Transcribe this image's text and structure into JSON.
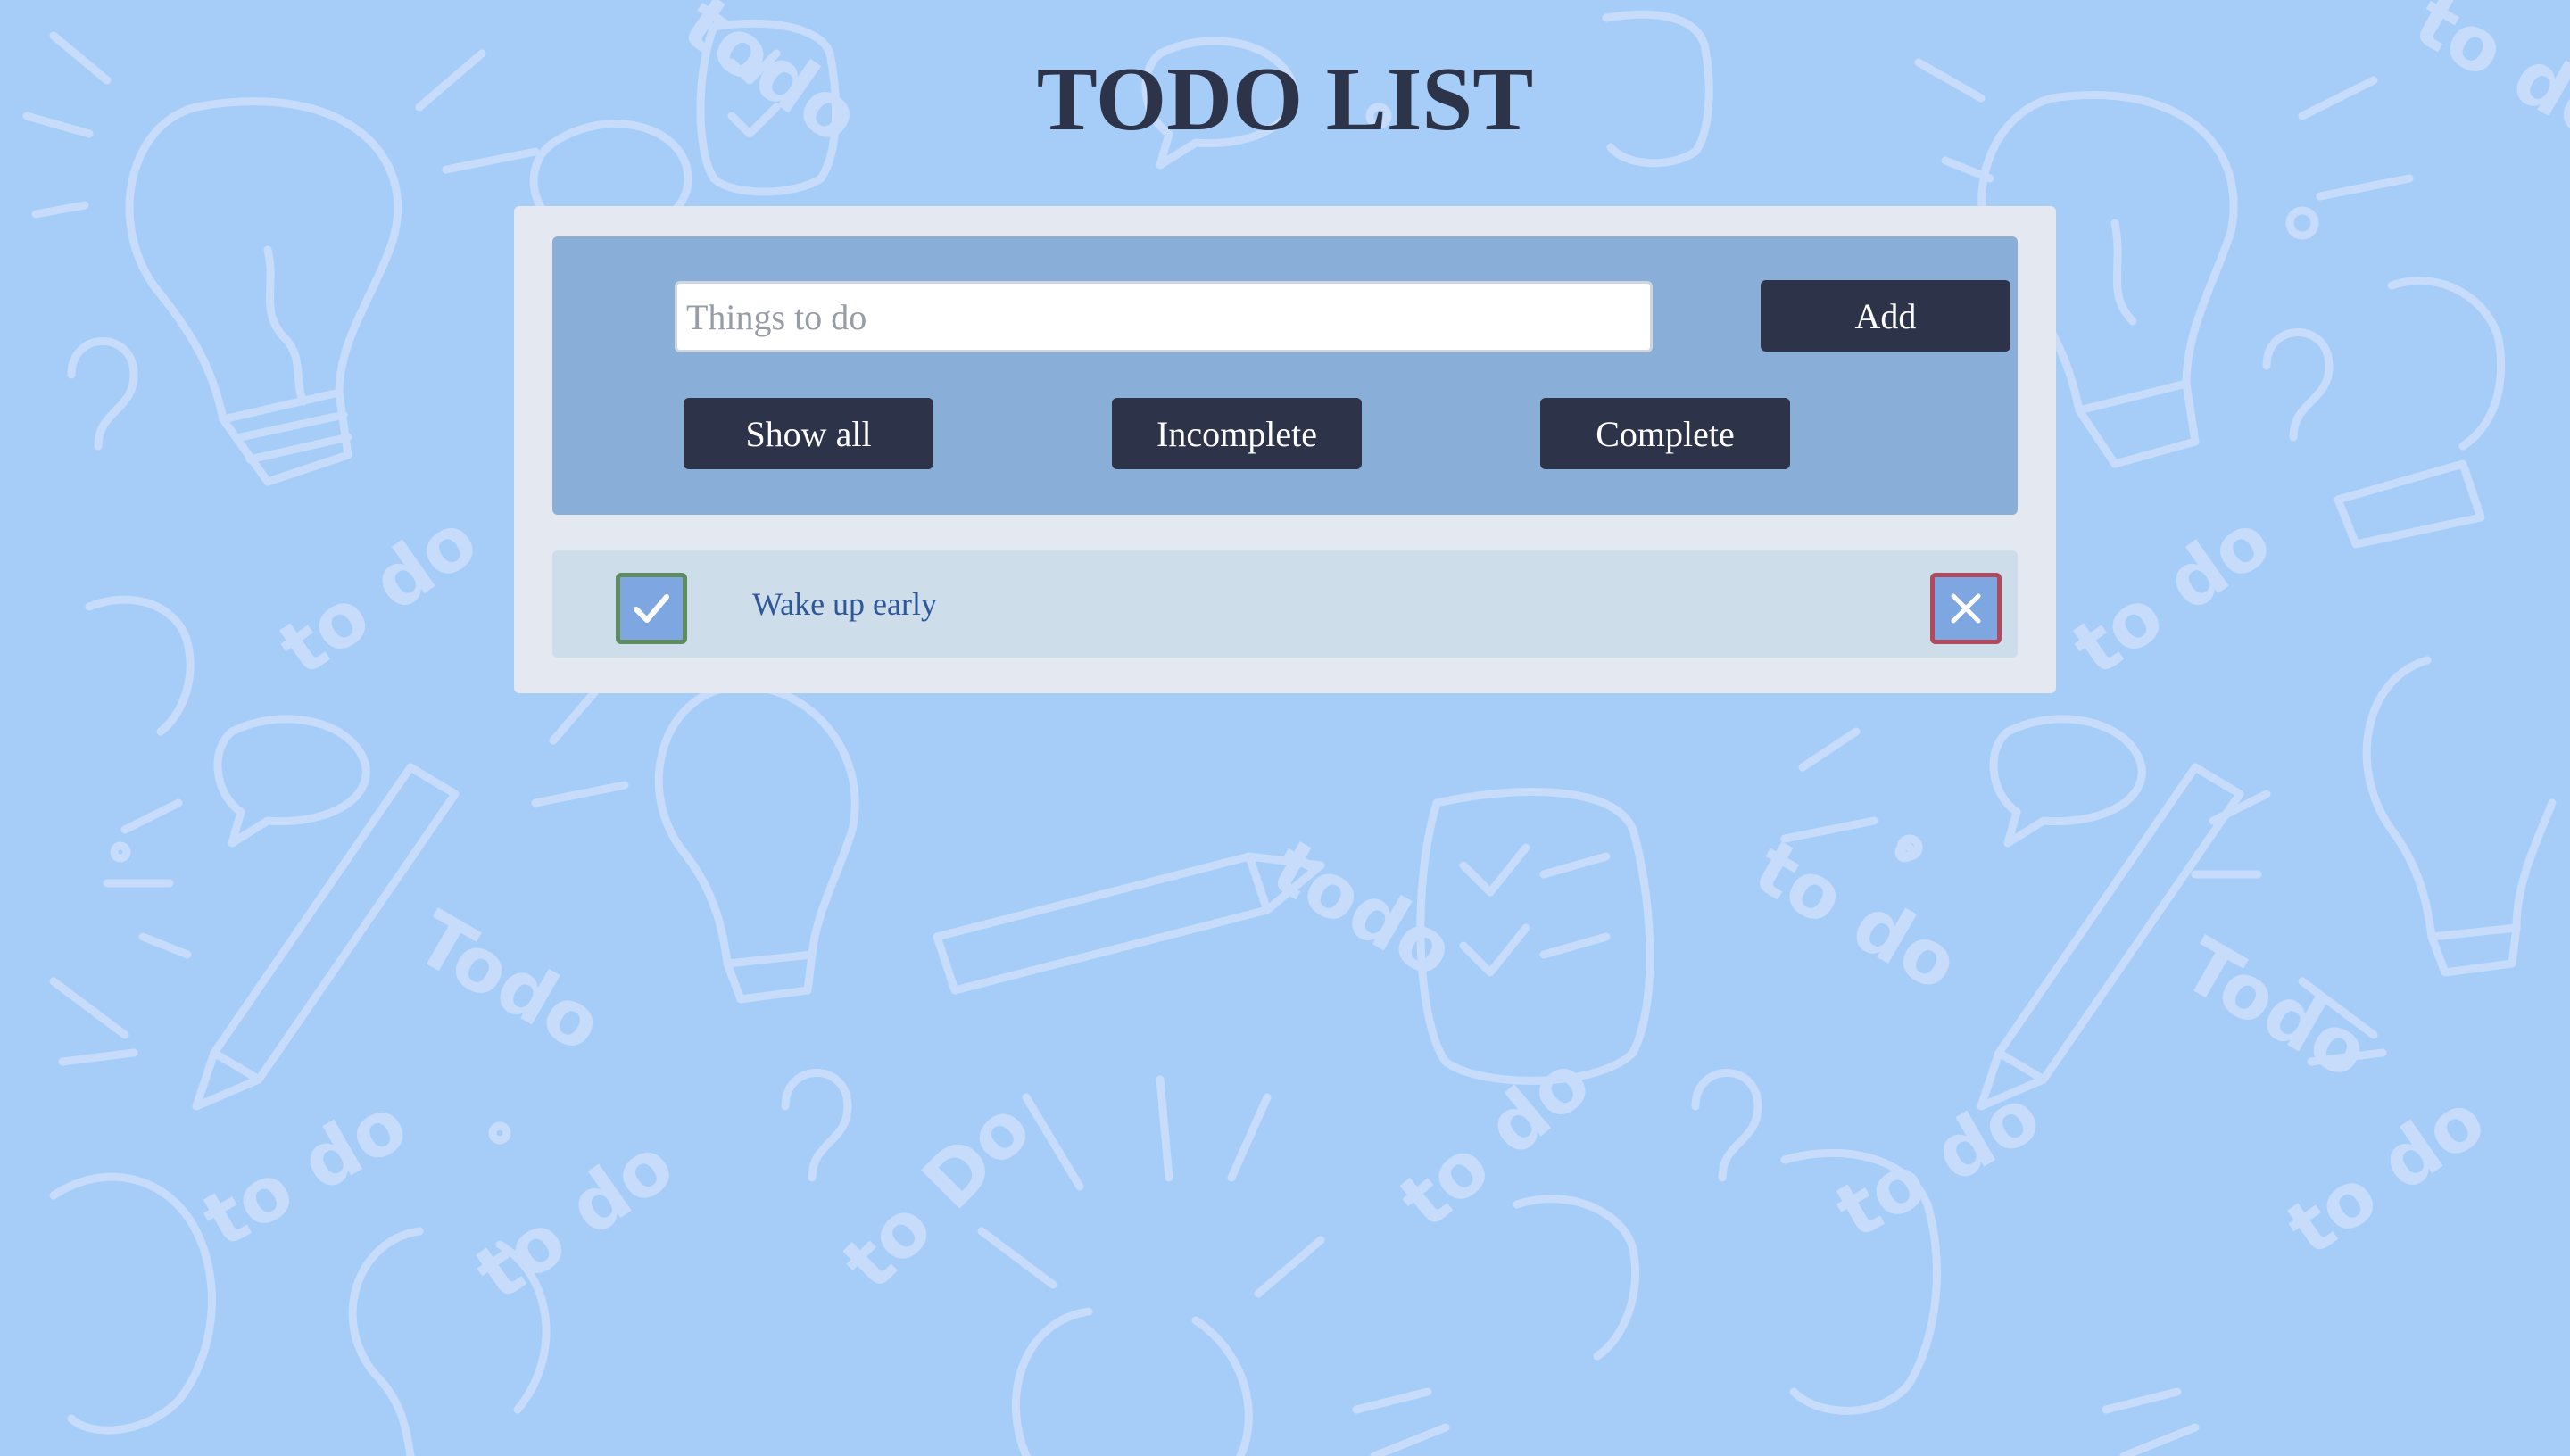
{
  "page": {
    "title": "TODO LIST"
  },
  "form": {
    "input_placeholder": "Things to do",
    "input_value": "",
    "add_label": "Add"
  },
  "filters": {
    "show_all_label": "Show all",
    "incomplete_label": "Incomplete",
    "complete_label": "Complete"
  },
  "todos": [
    {
      "text": "Wake up early",
      "check_icon": "check-icon",
      "delete_icon": "close-icon"
    }
  ],
  "colors": {
    "background": "#a5cdf8",
    "card": "#e3e8f1",
    "controls_panel": "#89afd9",
    "button": "#2d3449",
    "item_row": "#cdddea",
    "item_text": "#2e569b",
    "check_border": "#5e8c5f",
    "delete_border": "#b24a5e"
  }
}
